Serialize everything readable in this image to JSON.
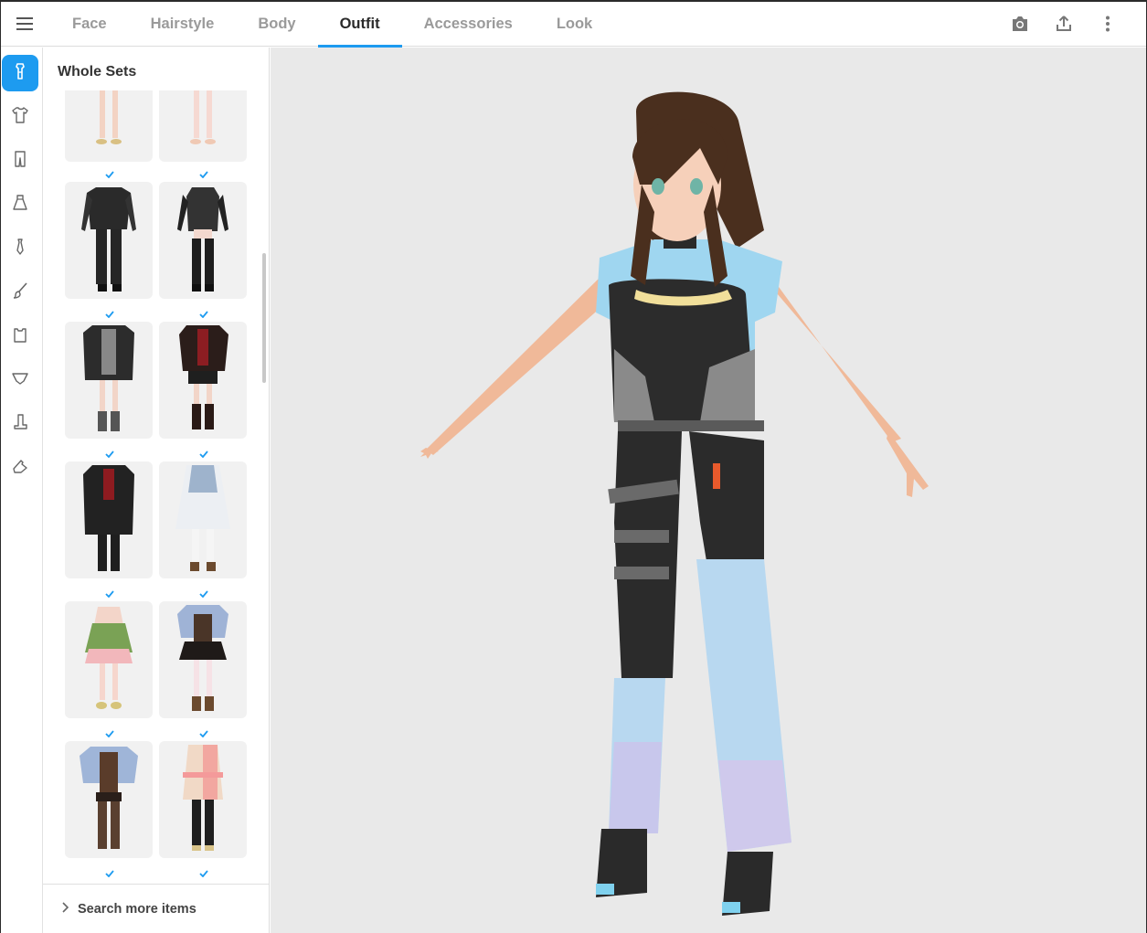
{
  "topbar": {
    "tabs": [
      {
        "label": "Face",
        "active": false
      },
      {
        "label": "Hairstyle",
        "active": false
      },
      {
        "label": "Body",
        "active": false
      },
      {
        "label": "Outfit",
        "active": true
      },
      {
        "label": "Accessories",
        "active": false
      },
      {
        "label": "Look",
        "active": false
      }
    ],
    "actions": [
      "camera-icon",
      "share-icon",
      "more-vertical-icon"
    ]
  },
  "rail": {
    "items": [
      {
        "icon": "whole-set-icon",
        "active": true
      },
      {
        "icon": "tshirt-icon",
        "active": false
      },
      {
        "icon": "pants-icon",
        "active": false
      },
      {
        "icon": "dress-icon",
        "active": false
      },
      {
        "icon": "tie-icon",
        "active": false
      },
      {
        "icon": "brush-icon",
        "active": false
      },
      {
        "icon": "bag-icon",
        "active": false
      },
      {
        "icon": "underwear-icon",
        "active": false
      },
      {
        "icon": "boot-icon",
        "active": false
      },
      {
        "icon": "shoe-icon",
        "active": false
      }
    ]
  },
  "panel": {
    "title": "Whole Sets",
    "items": [
      {
        "name": "gold-lace-dress-set",
        "checked": false
      },
      {
        "name": "pink-dress-set",
        "checked": false
      },
      {
        "name": "black-bodysuit-set",
        "checked": true
      },
      {
        "name": "black-corset-stockings-set",
        "checked": true
      },
      {
        "name": "black-jacket-shorts-set",
        "checked": true
      },
      {
        "name": "red-black-military-set",
        "checked": true
      },
      {
        "name": "black-red-coat-set",
        "checked": true
      },
      {
        "name": "white-blue-fantasy-set",
        "checked": true
      },
      {
        "name": "green-fairy-dress-set",
        "checked": true
      },
      {
        "name": "blue-corset-dress-set",
        "checked": true
      },
      {
        "name": "blue-brown-adventurer-set",
        "checked": true
      },
      {
        "name": "peach-black-casual-set",
        "checked": true
      }
    ],
    "footer_label": "Search more items"
  },
  "colors": {
    "accent": "#1d9bf0",
    "viewport_bg": "#e9e9e9"
  }
}
